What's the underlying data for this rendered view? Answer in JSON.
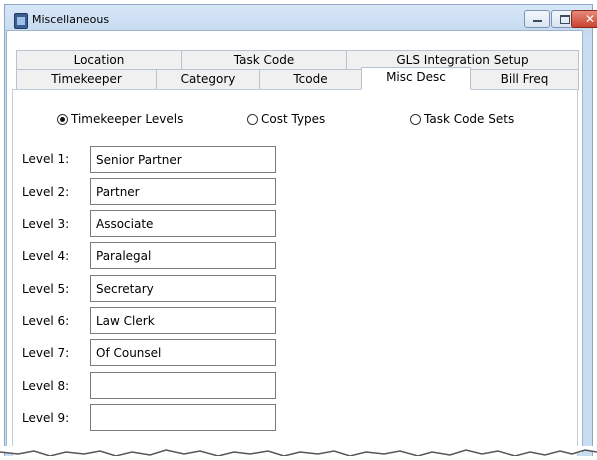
{
  "window": {
    "title": "Miscellaneous",
    "controls": {
      "minimize": "minimize",
      "maximize": "maximize",
      "close": "✕"
    }
  },
  "tabs_row1": [
    "Location",
    "Task Code",
    "GLS Integration Setup"
  ],
  "tabs_row2": [
    "Timekeeper",
    "Category",
    "Tcode",
    "Misc Desc",
    "Bill Freq"
  ],
  "active_tab": "Misc Desc",
  "radio_group": {
    "options": [
      "Timekeeper Levels",
      "Cost Types",
      "Task Code Sets"
    ],
    "selected": "Timekeeper Levels"
  },
  "levels": [
    {
      "label": "Level 1:",
      "value": "Senior Partner"
    },
    {
      "label": "Level 2:",
      "value": "Partner"
    },
    {
      "label": "Level 3:",
      "value": "Associate"
    },
    {
      "label": "Level 4:",
      "value": "Paralegal"
    },
    {
      "label": "Level 5:",
      "value": "Secretary"
    },
    {
      "label": "Level 6:",
      "value": "Law Clerk"
    },
    {
      "label": "Level 7:",
      "value": "Of Counsel"
    },
    {
      "label": "Level 8:",
      "value": ""
    },
    {
      "label": "Level 9:",
      "value": ""
    }
  ]
}
